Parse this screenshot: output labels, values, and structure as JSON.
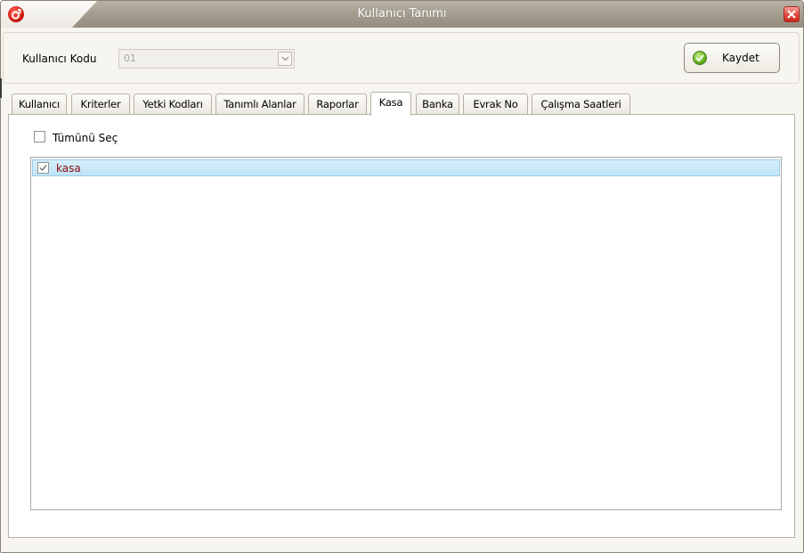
{
  "window": {
    "title": "Kullanıcı Tanımı"
  },
  "header": {
    "code_label": "Kullanıcı Kodu",
    "code_value": "01",
    "save_label": "Kaydet"
  },
  "tabs": [
    {
      "label": "Kullanıcı"
    },
    {
      "label": "Kriterler"
    },
    {
      "label": "Yetki Kodları"
    },
    {
      "label": "Tanımlı Alanlar"
    },
    {
      "label": "Raporlar"
    },
    {
      "label": "Kasa",
      "active": true
    },
    {
      "label": "Banka"
    },
    {
      "label": "Evrak No"
    },
    {
      "label": "Çalışma Saatleri"
    }
  ],
  "kasa_panel": {
    "select_all_label": "Tümünü Seç",
    "select_all_checked": false,
    "items": [
      {
        "label": "kasa",
        "checked": true,
        "selected": true
      }
    ]
  },
  "colors": {
    "titlebar": "#a29b8c",
    "selected_row": "#c9e8f8",
    "item_text": "#8b0a0a"
  }
}
